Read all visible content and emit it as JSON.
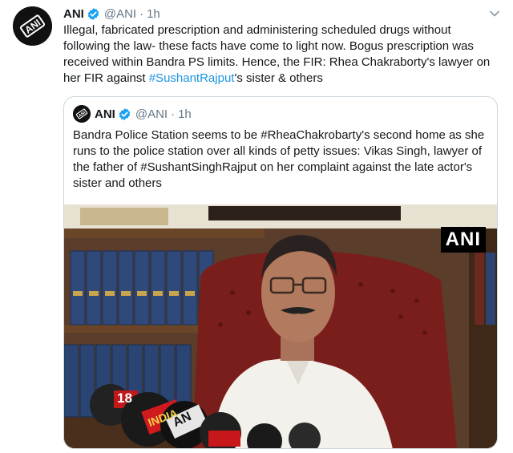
{
  "tweet": {
    "author_name": "ANI",
    "handle": "@ANI",
    "separator": "·",
    "time": "1h",
    "text_before_hashtag": "Illegal, fabricated prescription and administering scheduled drugs without following the law- these facts have come to light now. Bogus prescription was received within Bandra PS limits. Hence, the FIR: Rhea Chakraborty's lawyer on her FIR against ",
    "hashtag": "#SushantRajput",
    "text_after_hashtag": "'s sister & others",
    "avatar_logo_text": "ANI"
  },
  "quoted_tweet": {
    "author_name": "ANI",
    "handle": "@ANI",
    "separator": "·",
    "time": "1h",
    "text": "Bandra Police Station seems to be #RheaChakrobarty's second home as she runs to the police station over all kinds of petty issues: Vikas Singh, lawyer of the father of #SushantSinghRajput on her complaint against the late actor's sister and others",
    "media": {
      "watermark": "ANI",
      "mic_labels": [
        "18",
        "INDIA",
        "AN"
      ]
    }
  },
  "colors": {
    "link": "#1b95e0",
    "secondary_text": "#657786",
    "verified": "#1da1f2",
    "border": "#ccd6dd"
  },
  "icons": [
    "verified-badge-icon",
    "chevron-down-icon"
  ]
}
